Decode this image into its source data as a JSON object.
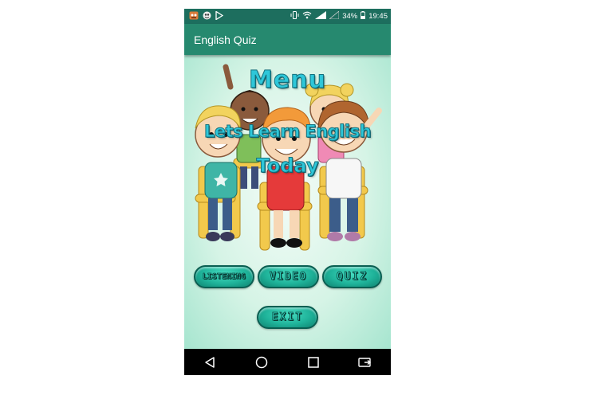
{
  "status_bar": {
    "battery_percent": "34%",
    "time": "19:45",
    "left_icons": [
      "app-notification-icon",
      "game-notification-icon",
      "play-store-icon"
    ],
    "right_icons": [
      "vibrate-icon",
      "wifi-icon",
      "signal-icon",
      "signal-empty-icon",
      "battery-icon"
    ]
  },
  "app_bar": {
    "title": "English Quiz"
  },
  "main": {
    "menu_title": "Menu",
    "subtitle_line1": "Lets Learn English",
    "subtitle_line2": "Today",
    "buttons": {
      "listening": "LISTENING",
      "video": "VIDEO",
      "quiz": "QUIZ",
      "exit": "EXIT"
    }
  },
  "nav_bar": {
    "icons": [
      "back-icon",
      "home-icon",
      "recents-icon",
      "screen-cast-icon"
    ]
  },
  "colors": {
    "status_bar": "#1d6e5e",
    "app_bar": "#26896f",
    "button": "#1fb39a",
    "title_text": "#2ec7d9"
  }
}
